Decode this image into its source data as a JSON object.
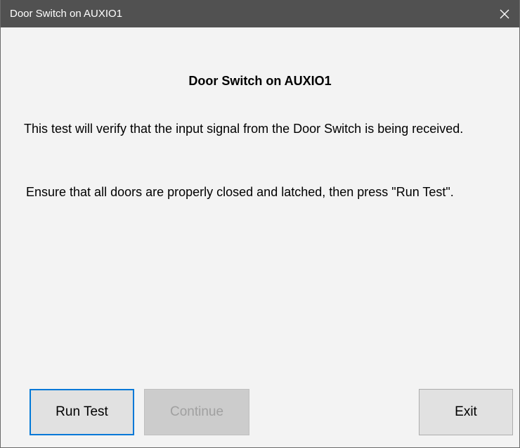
{
  "window": {
    "title": "Door Switch on AUXIO1"
  },
  "titlebar": {
    "close_icon": "close-icon"
  },
  "content": {
    "heading": "Door Switch on AUXIO1",
    "paragraph1": "This test will verify that the input signal from the Door Switch is being received.",
    "paragraph2": "Ensure that all doors are properly closed and latched, then press \"Run Test\"."
  },
  "buttons": {
    "run_test": "Run Test",
    "continue": "Continue",
    "exit": "Exit"
  },
  "colors": {
    "titlebar": "#515151",
    "accent_focus": "#0078d7",
    "body_bg": "#f3f3f3"
  }
}
